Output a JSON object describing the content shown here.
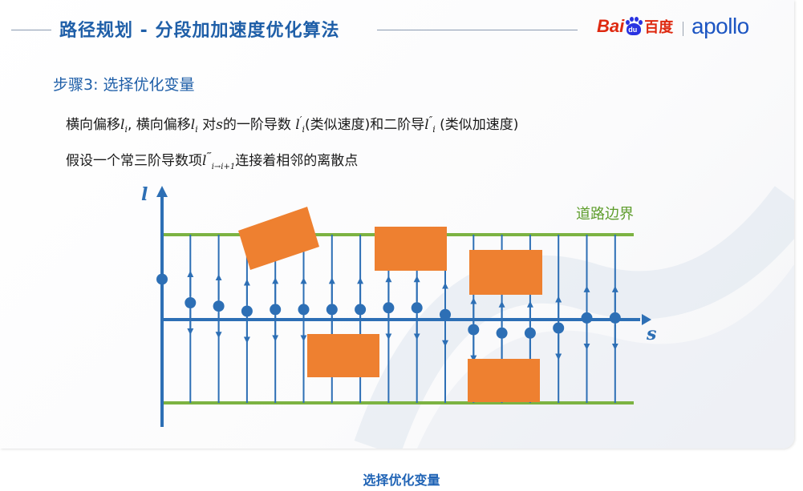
{
  "slide": {
    "title": "路径规划 - 分段加加速度优化算法",
    "logo": {
      "baidu_text": "Bai",
      "baidu_paw_text": "du",
      "baidu_cn": "百度",
      "apollo": "apollo"
    },
    "step_title": "步骤3: 选择优化变量",
    "line1": {
      "t1": "横向偏移",
      "v1": "l",
      "v1_sub": "i",
      "t2": ", 横向偏移",
      "v2": "l",
      "v2_sub": "i",
      "t3": " 对",
      "v3": "s",
      "t4": "的一阶导数 ",
      "v4": "l",
      "v4_sub": "i",
      "v4_sup": "′",
      "t5": "(类似速度)和二阶导",
      "v5": "l",
      "v5_sub": "i",
      "v5_sup": "″",
      "t6": " (类似加速度)"
    },
    "line2": {
      "t1": "假设一个常三阶导数项",
      "v1": "l",
      "v1_sup": "‴",
      "v1_sub": "i→i+1",
      "t2": "连接着相邻的离散点"
    }
  },
  "diagram": {
    "axis_l_label": "l",
    "axis_s_label": "s",
    "road_boundary_label": "道路边界",
    "colors": {
      "axis": "#2d6fb5",
      "boundary": "#7cb342",
      "obstacle": "#ee8030",
      "point": "#2d6fb5",
      "label_green": "#5e9d2c"
    },
    "num_stations": 17,
    "point_offsets": [
      0.48,
      0.2,
      0.16,
      0.1,
      0.12,
      0.12,
      0.12,
      0.12,
      0.14,
      0.14,
      0.06,
      -0.12,
      -0.16,
      -0.16,
      -0.1,
      0.02,
      0.02
    ]
  },
  "caption": "选择优化变量"
}
